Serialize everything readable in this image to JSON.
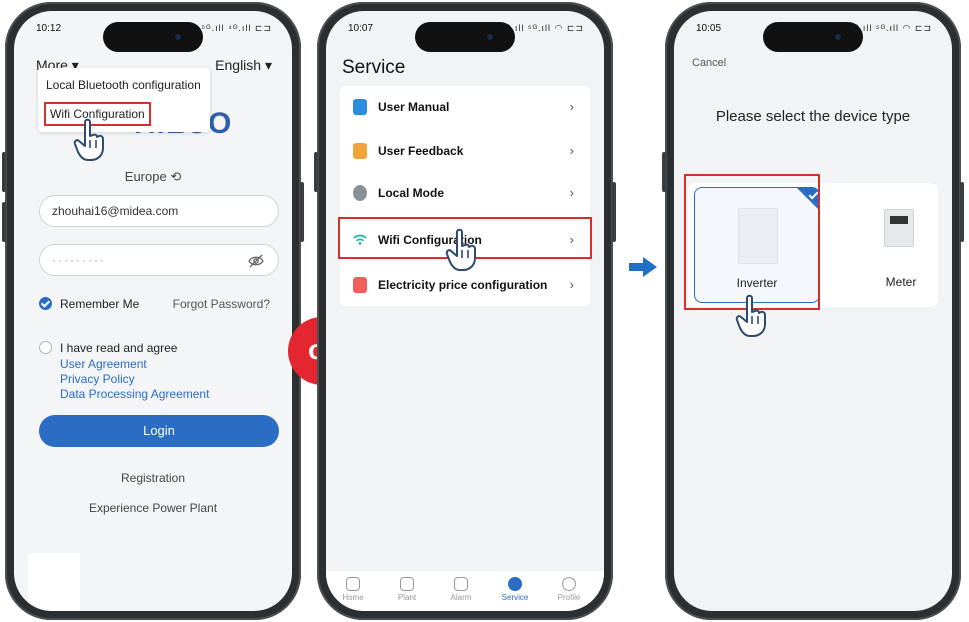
{
  "phone1": {
    "time": "10:12",
    "status_icons": "⚙ ▭ ⁵ᴳ.ıll ⁴ᴳ.ıll ⊏⊐",
    "more_label": "More ▾",
    "language_label": "English ▾",
    "dropdown": {
      "item_bluetooth": "Local Bluetooth configuration",
      "item_wifi": "Wifi Configuration"
    },
    "logo_text": "HILCO",
    "region": "Europe ⟲",
    "email_value": "zhouhai16@midea.com",
    "password_value": "·········",
    "remember_label": "Remember Me",
    "forgot_label": "Forgot Password?",
    "agree_label": "I have read and agree",
    "agree_links": [
      "User Agreement",
      "Privacy Policy",
      "Data Processing Agreement"
    ],
    "login_label": "Login",
    "registration_label": "Registration",
    "experience_label": "Experience Power Plant"
  },
  "or_label": "or",
  "phone2": {
    "time": "10:07",
    "status_icons": "⚙ ⁵ᴳ.ıll ⁵ᴳ.ıll ◠ ⊏⊐",
    "title": "Service",
    "menu": [
      {
        "label": "User Manual",
        "icon": "book-icon",
        "color": "#2b8de0"
      },
      {
        "label": "User Feedback",
        "icon": "feedback-icon",
        "color": "#f2a43c"
      },
      {
        "label": "Local Mode",
        "icon": "bluetooth-icon",
        "color": "#8a9299"
      },
      {
        "label": "Wifi Configuration",
        "icon": "wifi-icon",
        "color": "#1fb6a8"
      },
      {
        "label": "Electricity price configuration",
        "icon": "price-icon",
        "color": "#f0605a"
      }
    ],
    "chevron": "›",
    "tabs": [
      "Home",
      "Plant",
      "Alarm",
      "Service",
      "Profile"
    ]
  },
  "phone3": {
    "time": "10:05",
    "status_icons": "⚙ ⁵ᴳ.ıll ⁵ᴳ.ıll ◠ ⊏⊐",
    "cancel_label": "Cancel",
    "title": "Please select the device type",
    "devices": [
      {
        "label": "Inverter",
        "icon": "inverter-icon",
        "selected": true
      },
      {
        "label": "Meter",
        "icon": "meter-icon",
        "selected": false
      }
    ]
  },
  "colors": {
    "accent": "#2b6cc4",
    "highlight": "#d62d2d",
    "or_badge": "#e3262f"
  }
}
